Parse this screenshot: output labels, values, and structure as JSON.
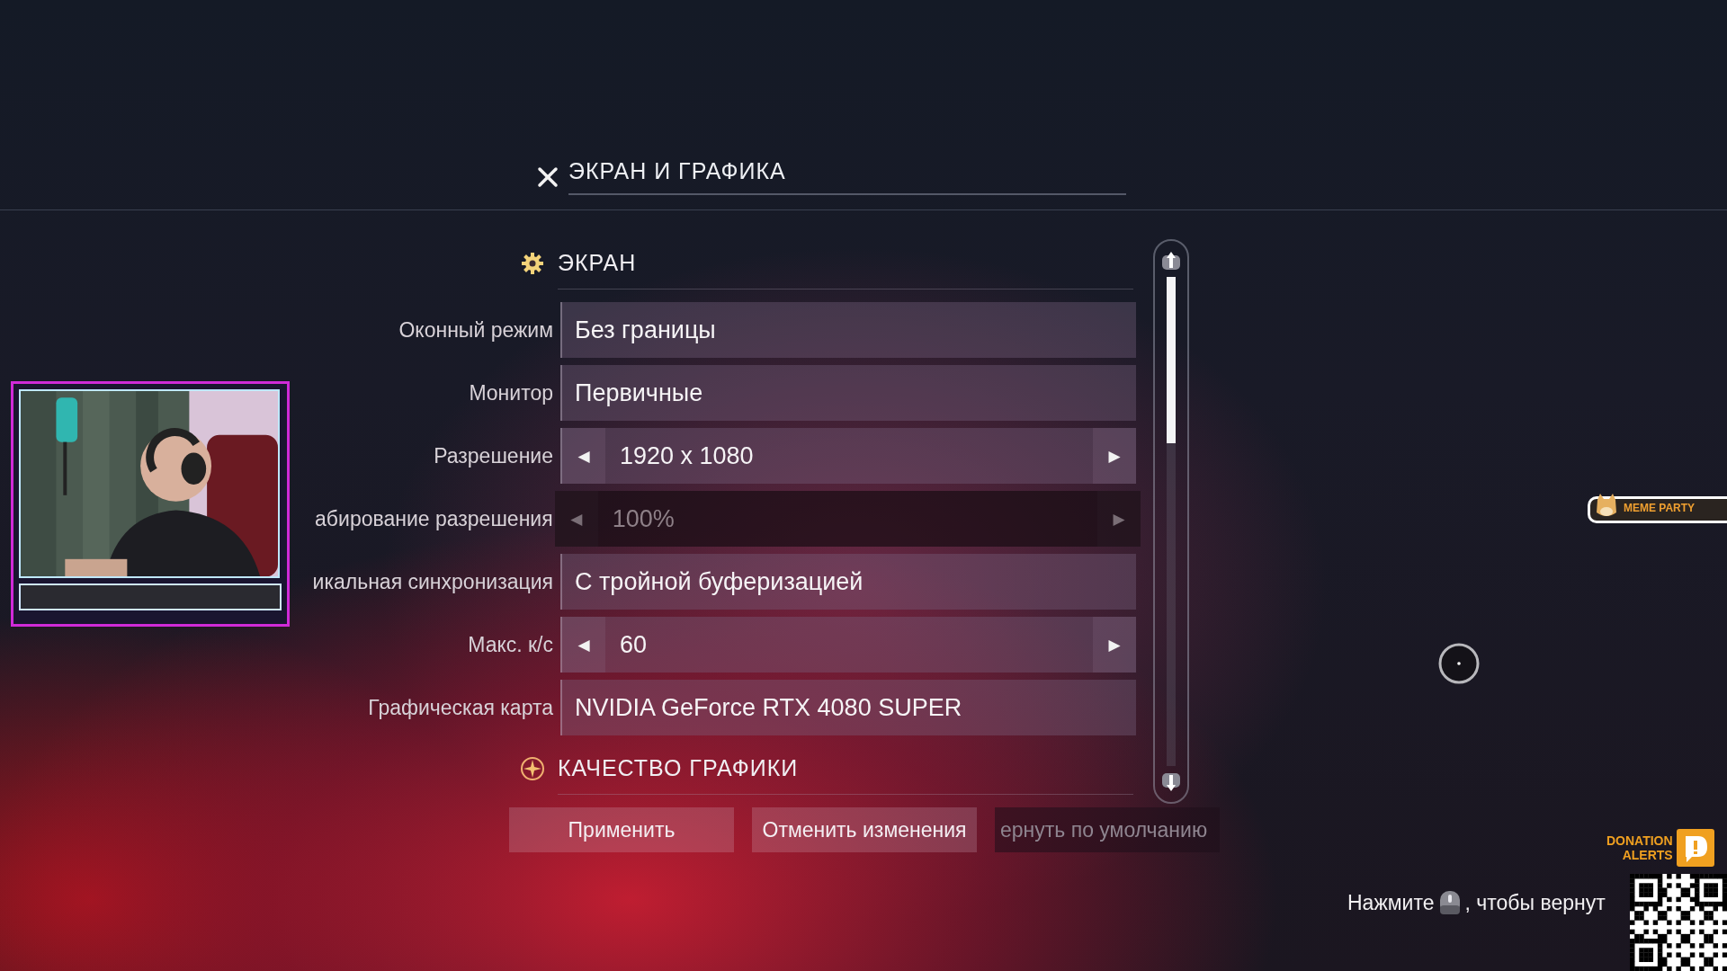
{
  "header": {
    "title": "ЭКРАН И ГРАФИКА"
  },
  "sections": [
    {
      "title": "ЭКРАН",
      "rows": [
        {
          "label": "Оконный режим",
          "kind": "dropdown",
          "value": "Без границы",
          "disabled": false
        },
        {
          "label": "Монитор",
          "kind": "dropdown",
          "value": "Первичные",
          "disabled": false
        },
        {
          "label": "Разрешение",
          "kind": "stepper",
          "value": "1920 x 1080",
          "prev": "◀",
          "next": "▶",
          "disabled": false
        },
        {
          "label": "абирование разрешения",
          "kind": "stepper",
          "value": "100%",
          "prev": "◀",
          "next": "▶",
          "disabled": true
        },
        {
          "label": "икальная синхронизация",
          "kind": "dropdown",
          "value": "С тройной буферизацией",
          "disabled": false
        },
        {
          "label": "Макс. к/с",
          "kind": "stepper",
          "value": "60",
          "prev": "◀",
          "next": "▶",
          "disabled": false
        },
        {
          "label": "Графическая карта",
          "kind": "dropdown",
          "value": "NVIDIA GeForce RTX 4080 SUPER",
          "disabled": false
        }
      ]
    },
    {
      "title": "КАЧЕСТВО ГРАФИКИ"
    }
  ],
  "buttons": [
    {
      "label": "Применить",
      "disabled": false
    },
    {
      "label": "Отменить изменения",
      "disabled": false
    },
    {
      "label": "ернуть по умолчанию",
      "disabled": true
    }
  ],
  "overlays": {
    "meme_widget": "MEME PARTY",
    "donation": [
      "DONATION",
      "ALERTS"
    ],
    "hint": {
      "before": "Нажмите",
      "after": ", чтобы вернут"
    }
  }
}
